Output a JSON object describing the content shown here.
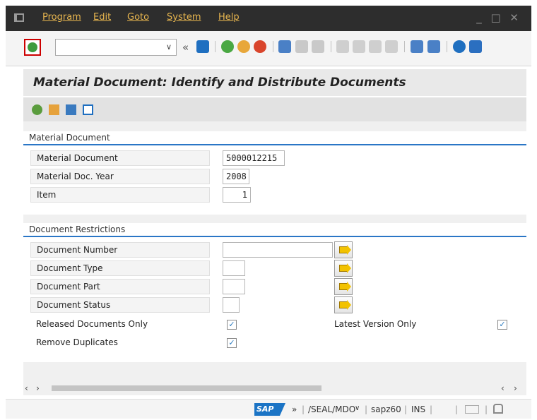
{
  "menu": {
    "items": [
      "Program",
      "Edit",
      "Goto",
      "System",
      "Help"
    ],
    "window_controls": "_ □ ✕"
  },
  "toolbar": {
    "command_value": "",
    "icons": [
      "enter-icon",
      "command-field",
      "back-double-icon",
      "save-icon",
      "back-icon",
      "exit-icon",
      "cancel-icon",
      "print-icon",
      "find-icon",
      "find-next-icon",
      "first-page-icon",
      "prev-page-icon",
      "next-page-icon",
      "last-page-icon",
      "create-session-icon",
      "shortcut-icon",
      "help-icon",
      "customize-icon"
    ]
  },
  "title": "Material Document: Identify and Distribute Documents",
  "app_toolbar": {
    "icons": [
      "execute-icon",
      "copy-icon",
      "variant-icon",
      "info-icon"
    ]
  },
  "material_group": {
    "title": "Material Document",
    "fields": [
      {
        "label": "Material Document",
        "value": "5000012215"
      },
      {
        "label": "Material Doc. Year",
        "value": "2008"
      },
      {
        "label": "Item",
        "value": "1"
      }
    ]
  },
  "restrictions_group": {
    "title": "Document Restrictions",
    "fields": [
      {
        "label": "Document Number",
        "value": ""
      },
      {
        "label": "Document Type",
        "value": ""
      },
      {
        "label": "Document Part",
        "value": ""
      },
      {
        "label": "Document Status",
        "value": ""
      }
    ],
    "checkboxes": [
      {
        "label": "Released Documents Only",
        "checked": true
      },
      {
        "label": "Remove Duplicates",
        "checked": true
      },
      {
        "label": "Latest Version Only",
        "checked": true
      }
    ]
  },
  "statusbar": {
    "logo": "SAP",
    "chevron": "»",
    "transaction": "/SEAL/MDO",
    "system": "sapz60",
    "mode": "INS",
    "separator": "|"
  },
  "colors": {
    "menubar_bg": "#2d2d2d",
    "menu_text": "#e8b64f",
    "accent_line": "#2a76c6",
    "checkbox_check": "#2a7abf"
  }
}
